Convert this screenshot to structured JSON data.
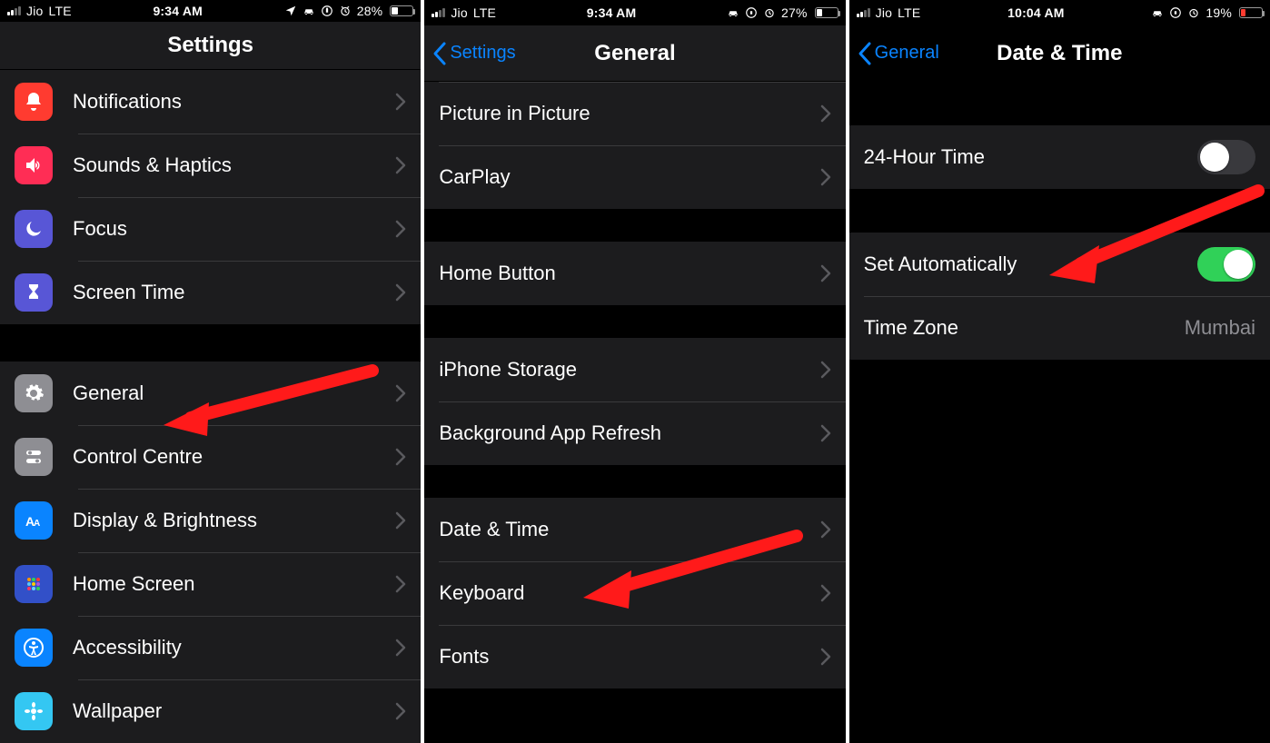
{
  "phones": {
    "settings": {
      "status": {
        "carrier": "Jio",
        "net": "LTE",
        "time": "9:34 AM",
        "battery_pct": "28%",
        "battery_fill": 28,
        "low": false
      },
      "title": "Settings",
      "rows": [
        {
          "label": "Notifications",
          "icon": "bell",
          "bg": "#ff3b30"
        },
        {
          "label": "Sounds & Haptics",
          "icon": "speaker",
          "bg": "#ff2d55"
        },
        {
          "label": "Focus",
          "icon": "moon",
          "bg": "#5856d6"
        },
        {
          "label": "Screen Time",
          "icon": "hourglass",
          "bg": "#5856d6"
        }
      ],
      "rows2": [
        {
          "label": "General",
          "icon": "gear",
          "bg": "#8e8e93"
        },
        {
          "label": "Control Centre",
          "icon": "switches",
          "bg": "#8e8e93"
        },
        {
          "label": "Display & Brightness",
          "icon": "aa",
          "bg": "#0a84ff"
        },
        {
          "label": "Home Screen",
          "icon": "grid",
          "bg": "#3250c8"
        },
        {
          "label": "Accessibility",
          "icon": "person",
          "bg": "#0a84ff"
        },
        {
          "label": "Wallpaper",
          "icon": "flower",
          "bg": "#34c7f2"
        }
      ]
    },
    "general": {
      "status": {
        "carrier": "Jio",
        "net": "LTE",
        "time": "9:34 AM",
        "battery_pct": "27%",
        "battery_fill": 27,
        "low": false
      },
      "back": "Settings",
      "title": "General",
      "groupA": [
        "Picture in Picture",
        "CarPlay"
      ],
      "groupB": [
        "Home Button"
      ],
      "groupC": [
        "iPhone Storage",
        "Background App Refresh"
      ],
      "groupD": [
        "Date & Time",
        "Keyboard",
        "Fonts"
      ]
    },
    "datetime": {
      "status": {
        "carrier": "Jio",
        "net": "LTE",
        "time": "10:04 AM",
        "battery_pct": "19%",
        "battery_fill": 19,
        "low": true
      },
      "back": "General",
      "title": "Date & Time",
      "row_24h": "24-Hour Time",
      "row_auto": "Set Automatically",
      "row_tz": "Time Zone",
      "tz_value": "Mumbai"
    }
  }
}
